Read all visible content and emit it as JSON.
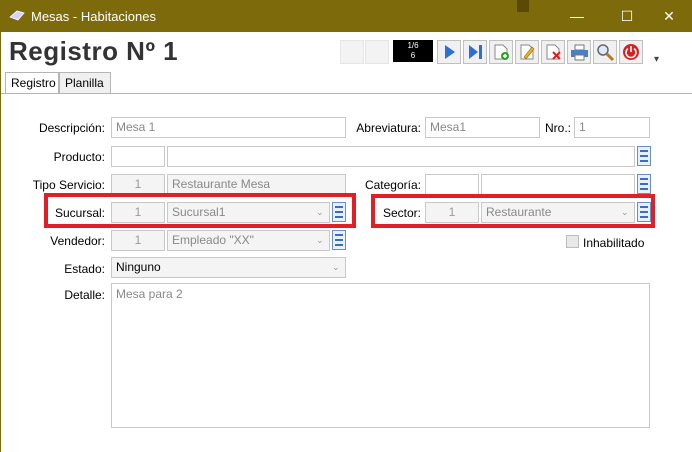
{
  "window": {
    "title": "Mesas - Habitaciones",
    "minimize": "—",
    "maximize": "☐",
    "close": "✕"
  },
  "header": {
    "record_title": "Registro Nº  1",
    "counter_top": "1/6",
    "counter_bottom": "6"
  },
  "tabs": [
    {
      "label": "Registro",
      "active": true
    },
    {
      "label": "Planilla",
      "active": false
    }
  ],
  "form": {
    "descripcion": {
      "label": "Descripción:",
      "value": "Mesa 1"
    },
    "abreviatura": {
      "label": "Abreviatura:",
      "value": "Mesa1"
    },
    "nro": {
      "label": "Nro.:",
      "value": "1"
    },
    "producto": {
      "label": "Producto:",
      "code": "",
      "value": ""
    },
    "tipo_servicio": {
      "label": "Tipo Servicio:",
      "code": "1",
      "value": "Restaurante Mesa"
    },
    "categoria": {
      "label": "Categoría:",
      "code": "",
      "value": ""
    },
    "sucursal": {
      "label": "Sucursal:",
      "code": "1",
      "value": "Sucursal1"
    },
    "sector": {
      "label": "Sector:",
      "code": "1",
      "value": "Restaurante"
    },
    "vendedor": {
      "label": "Vendedor:",
      "code": "1",
      "value": "Empleado \"XX\""
    },
    "inhabilitado": {
      "label": "Inhabilitado",
      "checked": false
    },
    "estado": {
      "label": "Estado:",
      "value": "Ninguno"
    },
    "detalle": {
      "label": "Detalle:",
      "value": "Mesa para 2"
    }
  },
  "colors": {
    "titlebar": "#7d6a0a",
    "highlight": "#e21f26"
  }
}
